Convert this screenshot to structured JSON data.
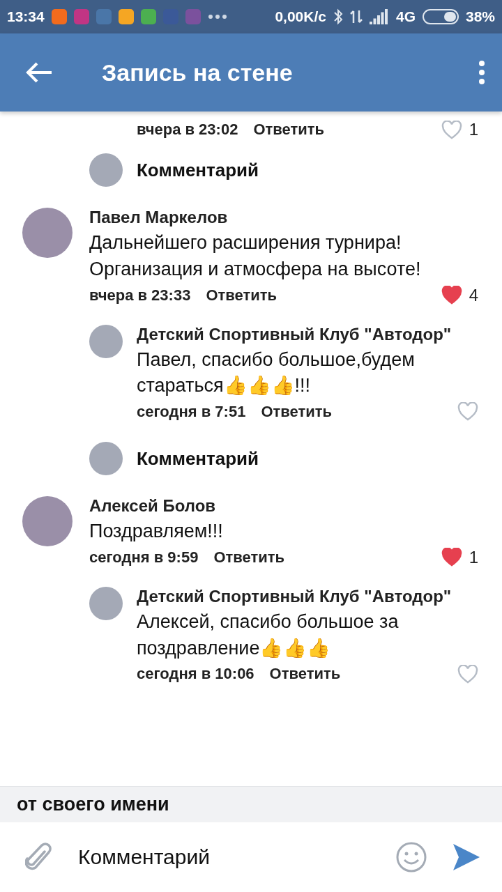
{
  "status_bar": {
    "time": "13:34",
    "speed": "0,00K/с",
    "network": "4G",
    "battery": "38%"
  },
  "app_bar": {
    "title": "Запись на стене"
  },
  "feed": [
    {
      "kind": "tail",
      "time": "вчера в 23:02",
      "reply": "Ответить",
      "liked": false,
      "likes": "1"
    },
    {
      "kind": "prompt",
      "label": "Комментарий"
    },
    {
      "kind": "comment",
      "author": "Павел Маркелов",
      "text": "Дальнейшего расширения турнира! Организация и атмосфера на высоте!",
      "time": "вчера в 23:33",
      "reply": "Ответить",
      "liked": true,
      "likes": "4",
      "children": [
        {
          "author": "Детский Спортивный Клуб \"Автодор\"",
          "text": "Павел, спасибо большое,будем стараться👍👍👍!!!",
          "time": "сегодня в 7:51",
          "reply": "Ответить",
          "liked": false
        }
      ]
    },
    {
      "kind": "prompt",
      "label": "Комментарий"
    },
    {
      "kind": "comment",
      "author": "Алексей Болов",
      "text": "Поздравляем!!!",
      "time": "сегодня в 9:59",
      "reply": "Ответить",
      "liked": true,
      "likes": "1",
      "children": [
        {
          "author": "Детский Спортивный Клуб \"Автодор\"",
          "text": "Алексей, спасибо большое за поздравление👍👍👍",
          "time": "сегодня в 10:06",
          "reply": "Ответить",
          "liked": false
        }
      ]
    }
  ],
  "composer": {
    "as_label": "от своего имени",
    "placeholder": "Комментарий"
  }
}
